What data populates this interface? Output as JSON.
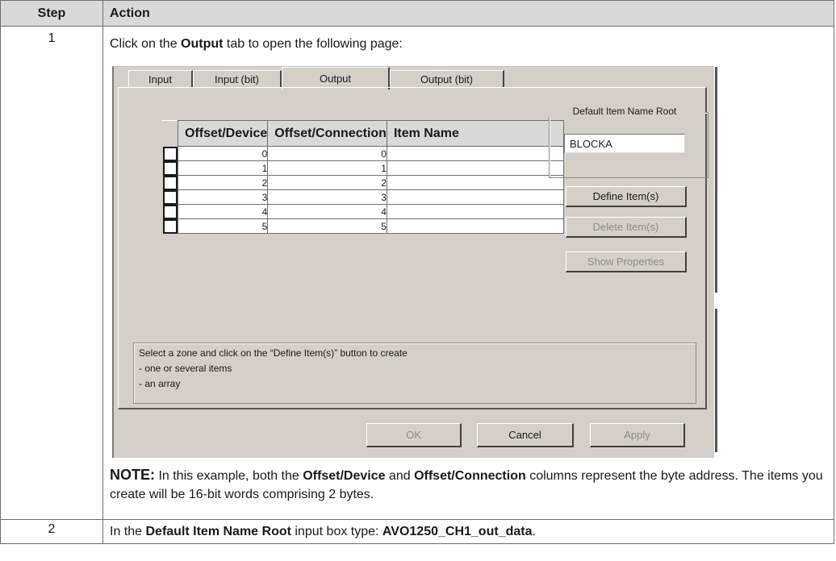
{
  "table": {
    "header": {
      "step": "Step",
      "action": "Action"
    },
    "rows": [
      {
        "step": "1",
        "intro_pre": "Click on the ",
        "intro_bold": "Output",
        "intro_post": " tab to open the following page:",
        "note_label": "NOTE:",
        "note_seg1": " In this example, both the ",
        "note_bold1": "Offset/Device",
        "note_seg2": " and ",
        "note_bold2": "Offset/Connection",
        "note_seg3": " columns represent the byte address. The items you create will be 16-bit words comprising 2 bytes."
      },
      {
        "step": "2",
        "pre": "In the ",
        "bold1": "Default Item Name Root",
        "mid": " input box type: ",
        "bold2": "AVO1250_CH1_out_data",
        "post": "."
      }
    ]
  },
  "dialog": {
    "tabs": [
      {
        "label": "Input",
        "active": false
      },
      {
        "label": "Input (bit)",
        "active": false
      },
      {
        "label": "Output",
        "active": true
      },
      {
        "label": "Output (bit)",
        "active": false
      }
    ],
    "grid": {
      "columns": [
        "Offset/Device",
        "Offset/Connection",
        "Item Name"
      ],
      "rows": [
        {
          "device": "0",
          "connection": "0",
          "name": ""
        },
        {
          "device": "1",
          "connection": "1",
          "name": ""
        },
        {
          "device": "2",
          "connection": "2",
          "name": ""
        },
        {
          "device": "3",
          "connection": "3",
          "name": ""
        },
        {
          "device": "4",
          "connection": "4",
          "name": ""
        },
        {
          "device": "5",
          "connection": "5",
          "name": ""
        }
      ]
    },
    "default_root": {
      "label": "Default Item Name Root",
      "value": "BLOCKA"
    },
    "buttons": {
      "define": "Define Item(s)",
      "delete": "Delete Item(s)",
      "show_properties": "Show Properties",
      "ok": "OK",
      "cancel": "Cancel",
      "apply": "Apply"
    },
    "hint": {
      "line1": "Select a zone and click on the “Define Item(s)” button to create",
      "line2": "- one or several items",
      "line3": "- an array"
    }
  }
}
